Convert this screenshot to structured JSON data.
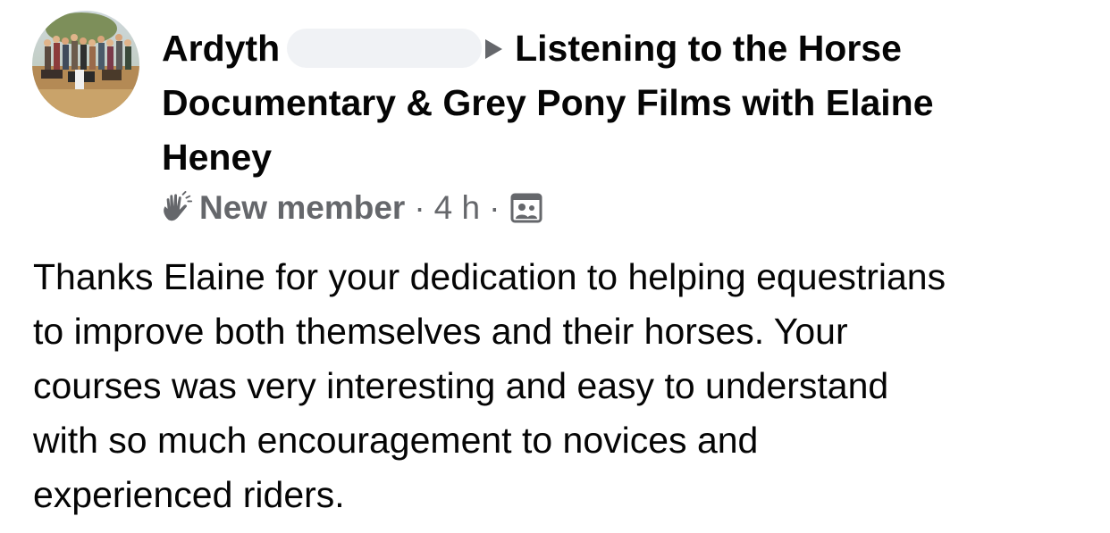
{
  "post": {
    "author": {
      "first_name": "Ardyth"
    },
    "group": {
      "name_line1": "Listening to the Horse",
      "name_line2": "Documentary & Grey Pony Films with Elaine",
      "name_line3": "Heney"
    },
    "meta": {
      "badge_icon": "waving-hand-icon",
      "badge_label": "New member",
      "separator": "·",
      "time": "4 h",
      "audience_icon": "group-members-icon"
    },
    "body": {
      "lines": [
        "Thanks Elaine for your dedication to helping equestrians",
        "to improve both themselves and their horses.  Your",
        "courses was very interesting and easy to understand",
        "with so much encouragement to novices and",
        "experienced riders."
      ]
    }
  },
  "colors": {
    "primary_text": "#050505",
    "secondary_text": "#65676b",
    "redaction": "#f0f2f5"
  }
}
